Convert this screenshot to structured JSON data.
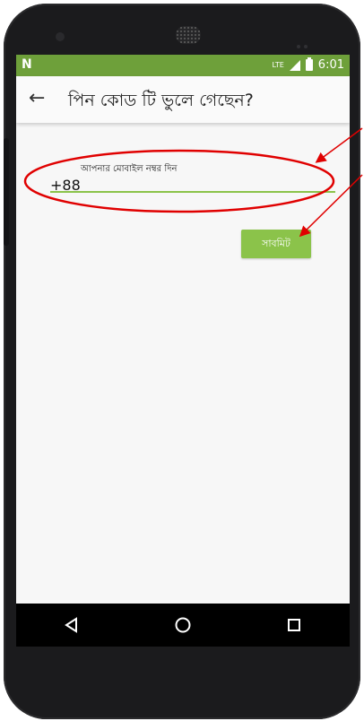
{
  "statusbar": {
    "notification_icon": "N",
    "network_label": "LTE",
    "time": "6:01"
  },
  "appbar": {
    "back_icon": "arrow-left-icon",
    "title": "পিন কোড টি ভুলে গেছেন?"
  },
  "form": {
    "mobile_label": "আপনার মোবাইল নম্বর দিন",
    "mobile_value": "+88",
    "submit_label": "সাবমিট"
  },
  "navbar": {
    "back": "back-triangle-icon",
    "home": "home-circle-icon",
    "recents": "recents-square-icon"
  },
  "colors": {
    "statusbar": "#6ea03a",
    "accent": "#8bc34a",
    "annotation": "#e00000"
  }
}
